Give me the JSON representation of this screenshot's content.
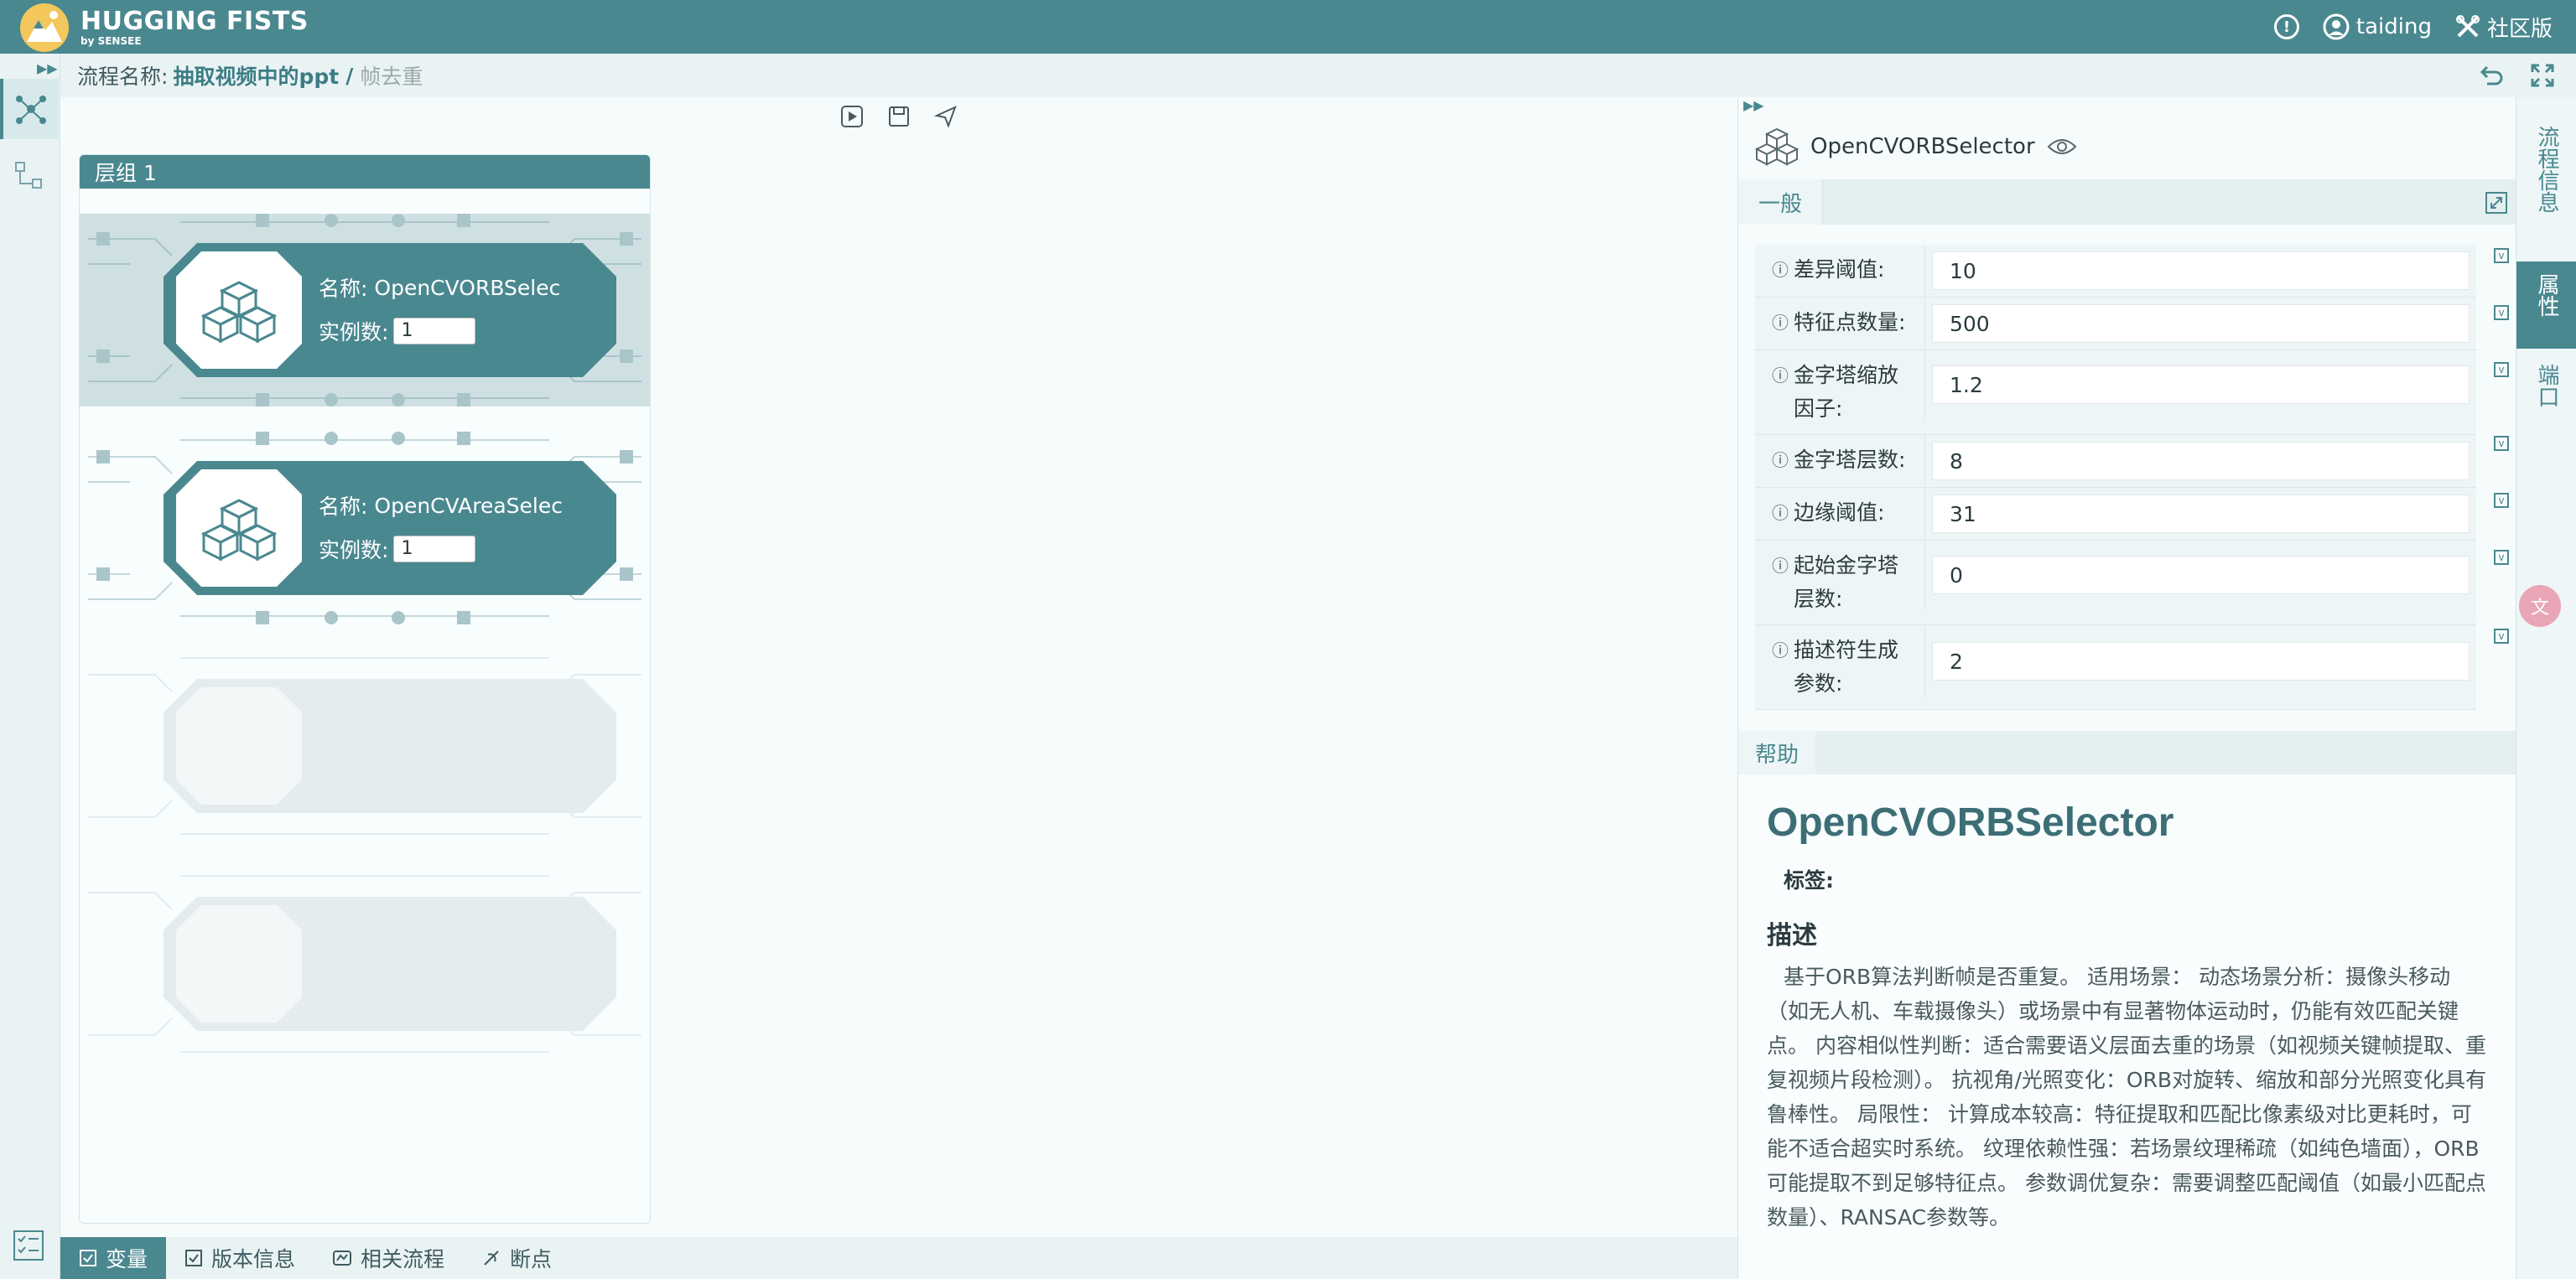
{
  "app": {
    "brand": "HUGGING FISTS",
    "brand_sub": "by SENSEE",
    "user": "taiding",
    "community": "社区版"
  },
  "breadcrumb": {
    "label": "流程名称:",
    "flow_name": "抽取视频中的ppt",
    "separator": "/",
    "current": "帧去重"
  },
  "canvas": {
    "group_title": "层组 1",
    "nodes": [
      {
        "name_label": "名称:",
        "name": "OpenCVORBSelec",
        "instances_label": "实例数:",
        "instances": "1"
      },
      {
        "name_label": "名称:",
        "name": "OpenCVAreaSelec",
        "instances_label": "实例数:",
        "instances": "1"
      }
    ]
  },
  "panel": {
    "title": "OpenCVORBSelector",
    "tab_general": "一般",
    "properties": [
      {
        "label": "差异阈值:",
        "value": "10"
      },
      {
        "label": "特征点数量:",
        "value": "500"
      },
      {
        "label": "金字塔缩放因子:",
        "value": "1.2"
      },
      {
        "label": "金字塔层数:",
        "value": "8"
      },
      {
        "label": "边缘阈值:",
        "value": "31"
      },
      {
        "label": "起始金字塔层数:",
        "value": "0"
      },
      {
        "label": "描述符生成参数:",
        "value": "2"
      }
    ],
    "help_tab": "帮助",
    "help": {
      "heading": "OpenCVORBSelector",
      "tags_label": "标签:",
      "desc_heading": "描述",
      "desc": "基于ORB算法判断帧是否重复。 适用场景： 动态场景分析：摄像头移动（如无人机、车载摄像头）或场景中有显著物体运动时，仍能有效匹配关键点。 内容相似性判断：适合需要语义层面去重的场景（如视频关键帧提取、重复视频片段检测）。 抗视角/光照变化：ORB对旋转、缩放和部分光照变化具有鲁棒性。 局限性： 计算成本较高：特征提取和匹配比像素级对比更耗时，可能不适合超实时系统。 纹理依赖性强：若场景纹理稀疏（如纯色墙面），ORB可能提取不到足够特征点。 参数调优复杂：需要调整匹配阈值（如最小匹配点数量）、RANSAC参数等。"
    }
  },
  "side_tabs": [
    "流程信息",
    "属性",
    "端口"
  ],
  "bottom_tabs": [
    "变量",
    "版本信息",
    "相关流程",
    "断点"
  ],
  "colors": {
    "primary": "#4a8890",
    "canvas_bg": "#f6fcfc",
    "node_fill": "#4a8890"
  }
}
